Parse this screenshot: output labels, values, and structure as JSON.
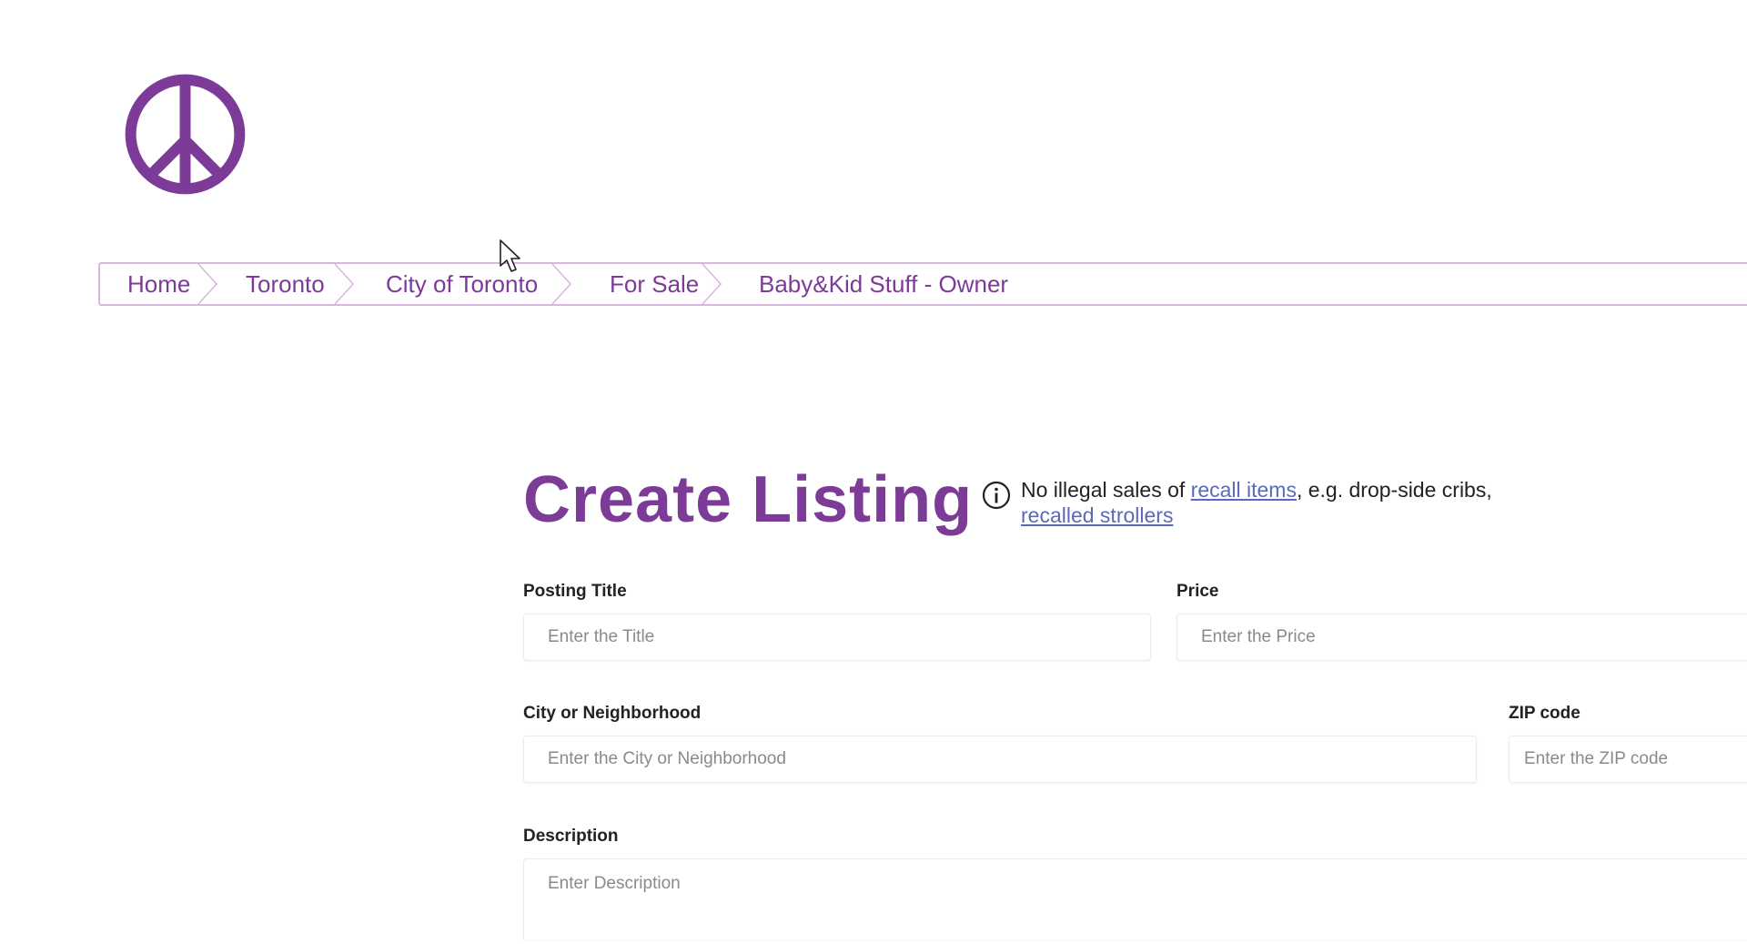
{
  "logo": {
    "icon": "peace-sign-icon",
    "color": "#7b3b96"
  },
  "breadcrumb": {
    "items": [
      {
        "label": "Home"
      },
      {
        "label": "Toronto"
      },
      {
        "label": "City of Toronto"
      },
      {
        "label": "For Sale"
      },
      {
        "label": "Baby&Kid Stuff - Owner"
      }
    ]
  },
  "page": {
    "title": "Create Listing"
  },
  "notice": {
    "icon": "info-icon",
    "prefix": "No illegal sales of",
    "link1": "recall items",
    "middle": ", e.g. drop-side cribs,",
    "link2": "recalled strollers"
  },
  "form": {
    "posting_title": {
      "label": "Posting Title",
      "placeholder": "Enter the Title",
      "value": ""
    },
    "price": {
      "label": "Price",
      "placeholder": "Enter the Price",
      "value": ""
    },
    "city": {
      "label": "City or Neighborhood",
      "placeholder": "Enter the City or Neighborhood",
      "value": ""
    },
    "zip": {
      "label": "ZIP code",
      "placeholder": "Enter the ZIP code",
      "value": ""
    },
    "description": {
      "label": "Description",
      "placeholder": "Enter Description",
      "value": ""
    }
  },
  "colors": {
    "accent": "#7b3b96",
    "breadcrumb_border": "#d9b5e0",
    "link": "#5a6ab8"
  }
}
